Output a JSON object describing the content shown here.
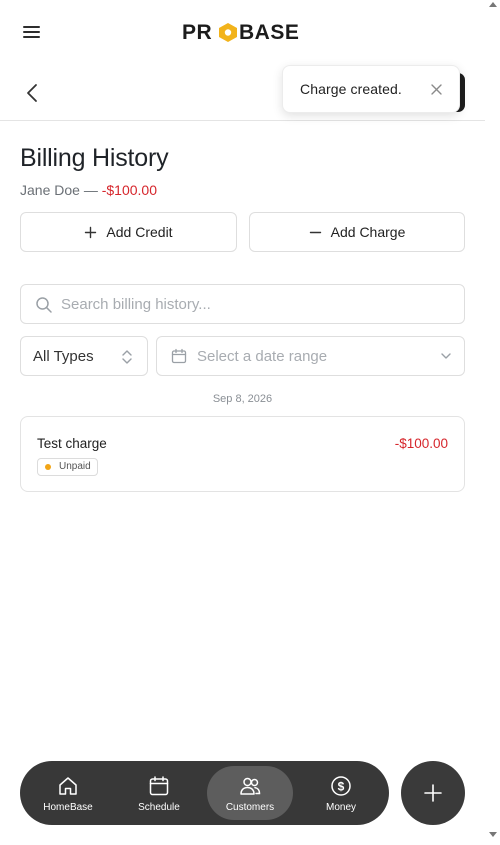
{
  "header": {
    "brand": "PROBASE",
    "menu_icon": "hamburger-icon",
    "back_icon": "chevron-left-icon"
  },
  "toast": {
    "message": "Charge created.",
    "close_icon": "close-icon"
  },
  "page": {
    "title": "Billing History",
    "customer_name": "Jane Doe",
    "separator": " — ",
    "balance": "-$100.00"
  },
  "actions": {
    "add_credit": "Add Credit",
    "add_charge": "Add Charge"
  },
  "search": {
    "placeholder": "Search billing history...",
    "value": ""
  },
  "filters": {
    "type_selected": "All Types",
    "date_placeholder": "Select a date range"
  },
  "groups": [
    {
      "date": "Sep 8, 2026",
      "entries": [
        {
          "title": "Test charge",
          "amount": "-$100.00",
          "status": "Unpaid"
        }
      ]
    }
  ],
  "bottom_nav": {
    "items": [
      {
        "label": "HomeBase",
        "icon": "home-icon"
      },
      {
        "label": "Schedule",
        "icon": "calendar-icon"
      },
      {
        "label": "Customers",
        "icon": "users-icon",
        "active": true
      },
      {
        "label": "Money",
        "icon": "dollar-circle-icon"
      }
    ],
    "fab_icon": "plus-icon"
  },
  "colors": {
    "negative": "#d6262c",
    "unpaid_dot": "#f2a516",
    "nav_bg": "#383838",
    "nav_active": "#5d5d5d",
    "brand_accent": "#f2b31b"
  }
}
